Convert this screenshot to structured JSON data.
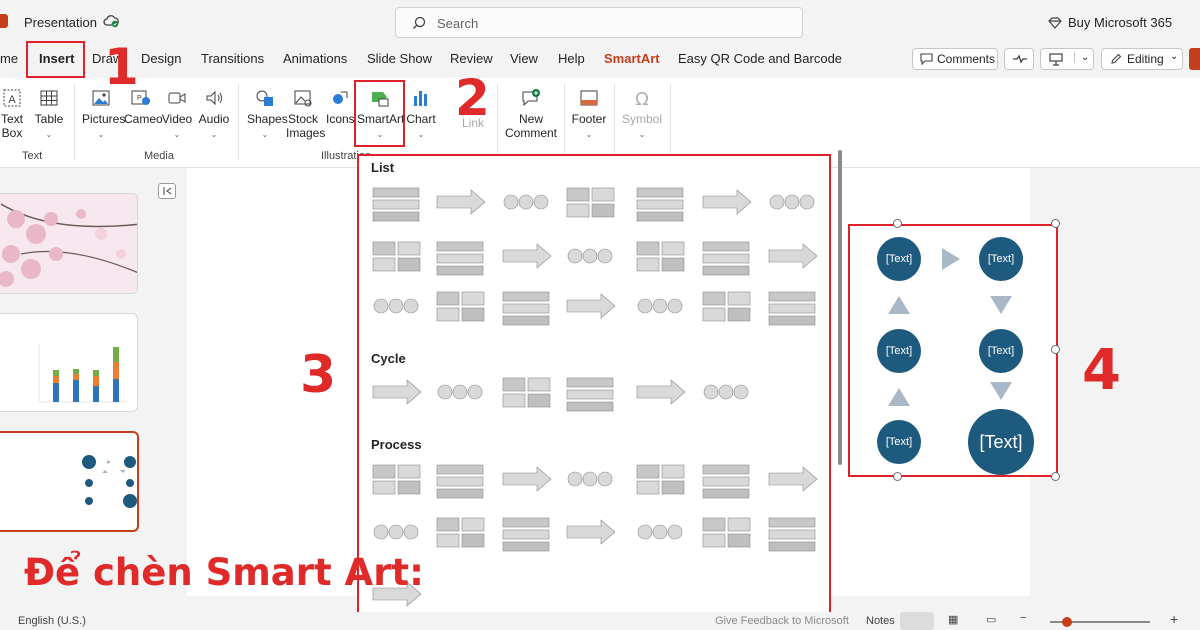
{
  "window": {
    "title": "Presentation",
    "search_placeholder": "Search",
    "buy_label": "Buy Microsoft 365"
  },
  "tabs": [
    "me",
    "Insert",
    "Draw",
    "Design",
    "Transitions",
    "Animations",
    "Slide Show",
    "Review",
    "View",
    "Help",
    "SmartArt",
    "Easy QR Code and Barcode"
  ],
  "top_buttons": {
    "comments": "Comments",
    "editing": "Editing"
  },
  "ribbon": {
    "text_box": "Text Box",
    "table": "Table",
    "group_text": "Text",
    "pictures": "Pictures",
    "cameo": "Cameo",
    "video": "Video",
    "audio": "Audio",
    "group_media": "Media",
    "shapes": "Shapes",
    "stock_images": "Stock Images",
    "icons": "Icons",
    "smartart": "SmartArt",
    "chart": "Chart",
    "group_illustrations": "Illustration",
    "link": "Link",
    "new_comment": "New Comment",
    "footer": "Footer",
    "symbol": "Symbol"
  },
  "gallery": {
    "sections": [
      "List",
      "Cycle",
      "Process"
    ]
  },
  "preview": {
    "node_label": "[Text]"
  },
  "annotations": {
    "n1": "1",
    "n2": "2",
    "n3": "3",
    "n4": "4",
    "caption": "Để chèn Smart Art:"
  },
  "status": {
    "language": "English (U.S.)",
    "feedback": "Give Feedback to Microsoft",
    "notes": "Notes"
  },
  "colors": {
    "accent": "#c43e1c",
    "annotation_red": "#e0202a",
    "smartart_blue": "#1e5a7e",
    "arrow_gray": "#a9b8c6"
  }
}
